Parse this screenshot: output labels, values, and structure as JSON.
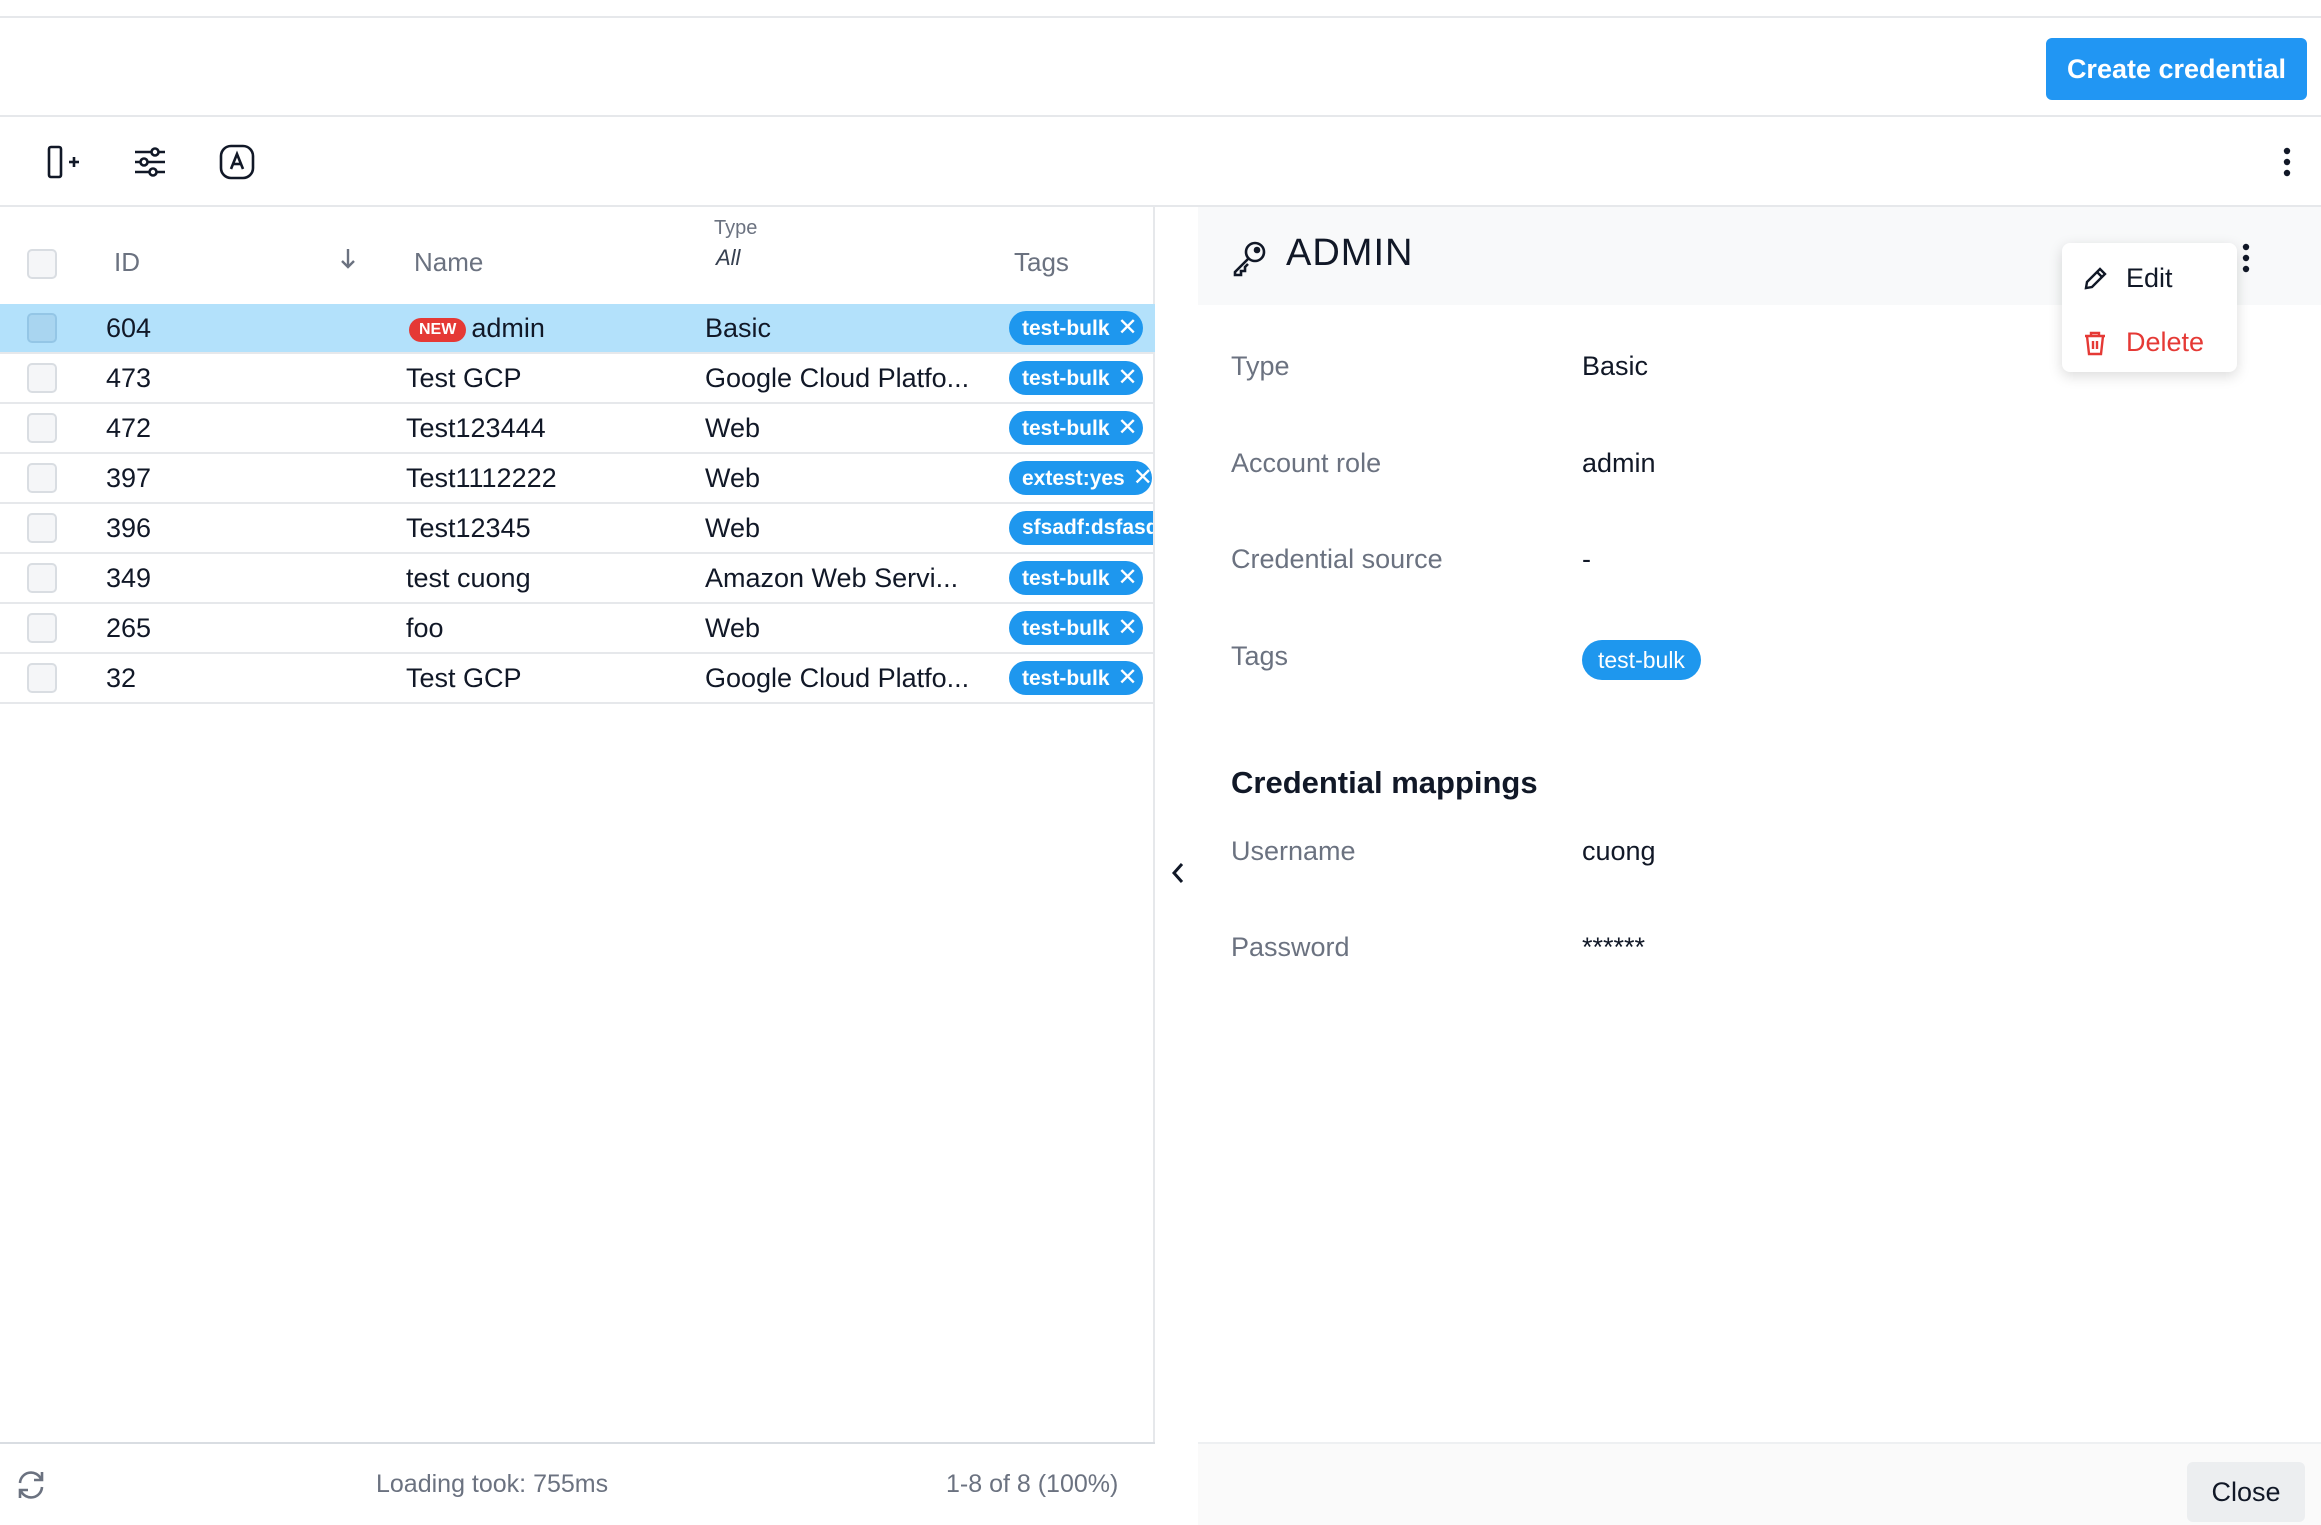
{
  "header": {
    "create_label": "Create credential"
  },
  "toolbar": {
    "icons": [
      "add-column-icon",
      "filter-sliders-icon",
      "account-icon",
      "more-vertical-icon"
    ]
  },
  "table": {
    "columns": {
      "id": "ID",
      "name": "Name",
      "type_label": "Type",
      "type_filter": "All",
      "tags": "Tags"
    },
    "new_badge": "NEW",
    "rows": [
      {
        "id": "604",
        "name": "admin",
        "type": "Basic",
        "tag": "test-bulk",
        "is_new": true,
        "selected": true
      },
      {
        "id": "473",
        "name": "Test GCP",
        "type": "Google Cloud Platfo...",
        "tag": "test-bulk"
      },
      {
        "id": "472",
        "name": "Test123444",
        "type": "Web",
        "tag": "test-bulk"
      },
      {
        "id": "397",
        "name": "Test1112222",
        "type": "Web",
        "tag": "extest:yes"
      },
      {
        "id": "396",
        "name": "Test12345",
        "type": "Web",
        "tag": "sfsadf:dsfasd"
      },
      {
        "id": "349",
        "name": "test cuong",
        "type": "Amazon Web Servi...",
        "tag": "test-bulk"
      },
      {
        "id": "265",
        "name": "foo",
        "type": "Web",
        "tag": "test-bulk"
      },
      {
        "id": "32",
        "name": "Test GCP",
        "type": "Google Cloud Platfo...",
        "tag": "test-bulk"
      }
    ]
  },
  "footer": {
    "loading": "Loading took: 755ms",
    "pagination": "1-8 of 8 (100%)"
  },
  "detail": {
    "title": "ADMIN",
    "fields": [
      {
        "label": "Type",
        "value": "Basic"
      },
      {
        "label": "Account role",
        "value": "admin"
      },
      {
        "label": "Credential source",
        "value": "-"
      },
      {
        "label": "Tags",
        "value": ""
      }
    ],
    "tag": "test-bulk",
    "section_title": "Credential mappings",
    "mappings": [
      {
        "label": "Username",
        "value": "cuong"
      },
      {
        "label": "Password",
        "value": "******"
      }
    ],
    "close_label": "Close"
  },
  "menu": {
    "edit": "Edit",
    "delete": "Delete"
  },
  "colors": {
    "accent": "#2196f3",
    "tag": "#1e97ee",
    "selected_row": "#b3e1fb",
    "danger": "#e53935"
  }
}
